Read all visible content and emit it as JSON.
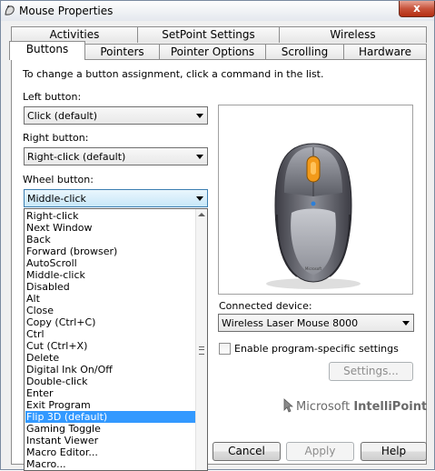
{
  "window": {
    "title": "Mouse Properties",
    "close_glyph": "x"
  },
  "tabs_back": [
    "Activities",
    "SetPoint Settings",
    "Wireless"
  ],
  "tabs_front": [
    "Buttons",
    "Pointers",
    "Pointer Options",
    "Scrolling",
    "Hardware"
  ],
  "active_tab": "Buttons",
  "instructions": "To change a button assignment, click a command in the list.",
  "left_button": {
    "label": "Left button:",
    "value": "Click (default)"
  },
  "right_button": {
    "label": "Right button:",
    "value": "Right-click (default)"
  },
  "wheel_button": {
    "label": "Wheel button:",
    "value": "Middle-click"
  },
  "dropdown": {
    "items": [
      "Right-click",
      "Next Window",
      "Back",
      "Forward (browser)",
      "AutoScroll",
      "Middle-click",
      "Disabled",
      "Alt",
      "Close",
      "Copy (Ctrl+C)",
      "Ctrl",
      "Cut (Ctrl+X)",
      "Delete",
      "Digital Ink On/Off",
      "Double-click",
      "Enter",
      "Exit Program",
      "Flip 3D (default)",
      "Gaming Toggle",
      "Instant Viewer",
      "Macro Editor...",
      "Macro..."
    ],
    "selected": "Flip 3D (default)"
  },
  "device": {
    "label": "Connected device:",
    "value": "Wireless Laser Mouse 8000",
    "image_alt": "mouse-illustration"
  },
  "program_specific": {
    "label": "Enable program-specific settings",
    "checked": false
  },
  "settings_button": "Settings...",
  "brand": {
    "prefix": "Microsoft",
    "name": "IntelliPoint"
  },
  "buttons": {
    "cancel": "Cancel",
    "apply": "Apply",
    "help": "Help"
  },
  "colors": {
    "selection": "#3399ff",
    "accent_orange": "#f29a1a",
    "close": "#c7533b"
  }
}
